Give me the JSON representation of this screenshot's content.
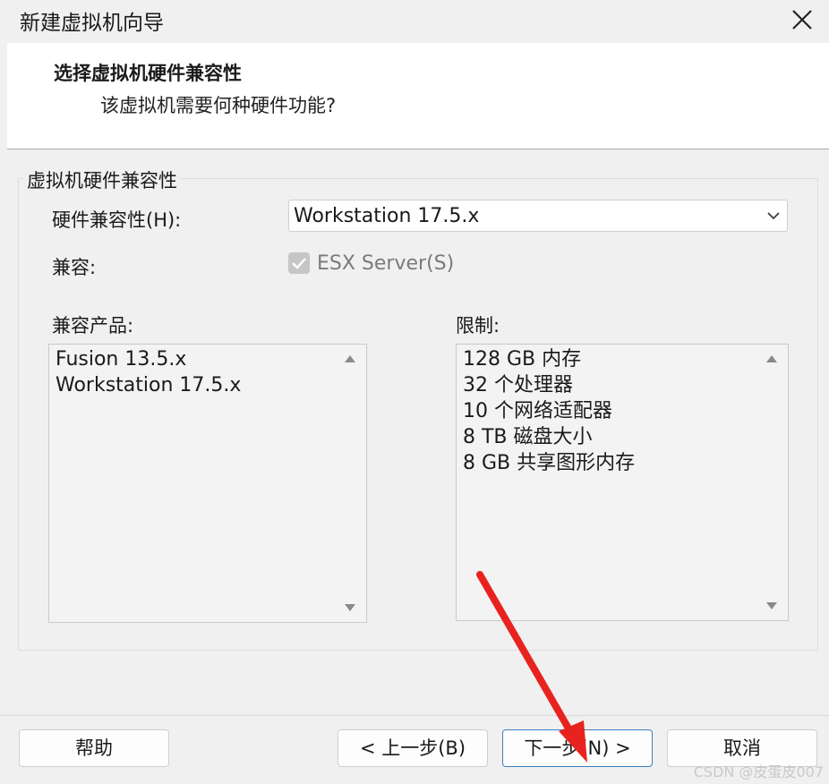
{
  "window": {
    "title": "新建虚拟机向导"
  },
  "header": {
    "title": "选择虚拟机硬件兼容性",
    "subtitle": "该虚拟机需要何种硬件功能?"
  },
  "group": {
    "label": "虚拟机硬件兼容性",
    "compat_label": "硬件兼容性(H):",
    "compat_value": "Workstation 17.5.x",
    "compatible_label": "兼容:",
    "esx_label": "ESX Server(S)",
    "esx_checked": true,
    "products_label": "兼容产品:",
    "products": [
      "Fusion 13.5.x",
      "Workstation 17.5.x"
    ],
    "limits_label": "限制:",
    "limits": [
      "128 GB 内存",
      "32 个处理器",
      "10 个网络适配器",
      "8 TB 磁盘大小",
      "8 GB 共享图形内存"
    ]
  },
  "buttons": {
    "help": "帮助",
    "back": "< 上一步(B)",
    "next": "下一步(N) >",
    "cancel": "取消"
  },
  "watermark": "CSDN @皮蛋皮007",
  "colors": {
    "accent": "#3b7dc0",
    "annotation_arrow": "#e8231f"
  }
}
